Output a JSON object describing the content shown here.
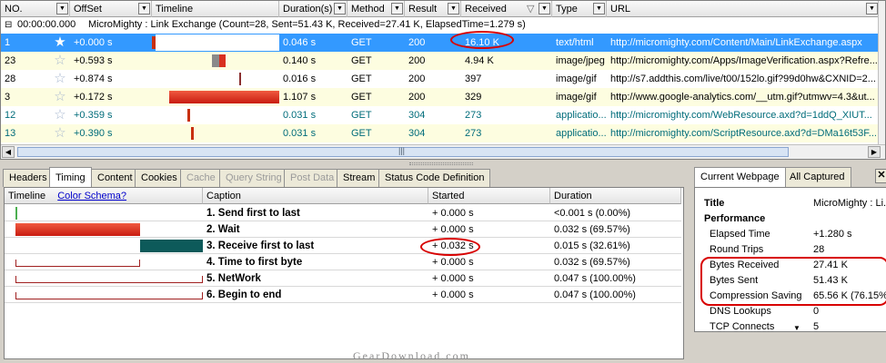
{
  "grid": {
    "headers": [
      "NO.",
      "OffSet",
      "Timeline",
      "Duration(s)",
      "Method",
      "Result",
      "Received",
      "Type",
      "URL"
    ],
    "summary": {
      "time": "00:00:00.000",
      "text": "MicroMighty : Link Exchange  (Count=28, Sent=51.43 K, Received=27.41 K, ElapsedTime=1.279 s)"
    },
    "rows": [
      {
        "no": "1",
        "offset": "+0.000 s",
        "duration": "0.046 s",
        "method": "GET",
        "result": "200",
        "received": "16.10 K",
        "type": "text/html",
        "url": "http://micromighty.com/Content/Main/LinkExchange.aspx",
        "starred": true,
        "style": "sel"
      },
      {
        "no": "23",
        "offset": "+0.593 s",
        "duration": "0.140 s",
        "method": "GET",
        "result": "200",
        "received": "4.94 K",
        "type": "image/jpeg",
        "url": "http://micromighty.com/Apps/ImageVerification.aspx?Refre...",
        "starred": false,
        "style": "cream"
      },
      {
        "no": "28",
        "offset": "+0.874 s",
        "duration": "0.016 s",
        "method": "GET",
        "result": "200",
        "received": "397",
        "type": "image/gif",
        "url": "http://s7.addthis.com/live/t00/152lo.gif?99d0hw&CXNID=2...",
        "starred": false,
        "style": "white"
      },
      {
        "no": "3",
        "offset": "+0.172 s",
        "duration": "1.107 s",
        "method": "GET",
        "result": "200",
        "received": "329",
        "type": "image/gif",
        "url": "http://www.google-analytics.com/__utm.gif?utmwv=4.3&ut...",
        "starred": false,
        "style": "cream"
      },
      {
        "no": "12",
        "offset": "+0.359 s",
        "duration": "0.031 s",
        "method": "GET",
        "result": "304",
        "received": "273",
        "type": "applicatio...",
        "url": "http://micromighty.com/WebResource.axd?d=1ddQ_XIUT...",
        "starred": false,
        "style": "white",
        "teal": true
      },
      {
        "no": "13",
        "offset": "+0.390 s",
        "duration": "0.031 s",
        "method": "GET",
        "result": "304",
        "received": "273",
        "type": "applicatio...",
        "url": "http://micromighty.com/ScriptResource.axd?d=DMa16t53F...",
        "starred": false,
        "style": "cream",
        "teal": true
      }
    ]
  },
  "tabs": [
    "Headers",
    "Timing",
    "Content",
    "Cookies",
    "Cache",
    "Query String",
    "Post Data",
    "Stream",
    "Status Code Definition"
  ],
  "timing": {
    "headers": {
      "timeline": "Timeline",
      "schema_link": "Color Schema?",
      "caption": "Caption",
      "started": "Started",
      "duration": "Duration"
    },
    "rows": [
      {
        "caption": "1.   Send first to last",
        "started": "+ 0.000 s",
        "duration": "<0.001 s  (0.00%)"
      },
      {
        "caption": "2.   Wait",
        "started": "+ 0.000 s",
        "duration": "0.032 s  (69.57%)"
      },
      {
        "caption": "3.   Receive first to last",
        "started": "+ 0.032 s",
        "duration": "0.015 s  (32.61%)"
      },
      {
        "caption": "4.   Time to first byte",
        "started": "+ 0.000 s",
        "duration": "0.032 s  (69.57%)"
      },
      {
        "caption": "5.   NetWork",
        "started": "+ 0.000 s",
        "duration": "0.047 s  (100.00%)"
      },
      {
        "caption": "6.   Begin to end",
        "started": "+ 0.000 s",
        "duration": "0.047 s  (100.00%)"
      }
    ]
  },
  "right_panel": {
    "tabs": [
      "Current Webpage",
      "All Captured"
    ],
    "title_label": "Title",
    "title_value": "MicroMighty : Li...",
    "section": "Performance",
    "items": [
      {
        "label": "Elapsed Time",
        "value": "+1.280 s"
      },
      {
        "label": "Round Trips",
        "value": "28"
      },
      {
        "label": "Bytes Received",
        "value": "27.41 K"
      },
      {
        "label": "Bytes Sent",
        "value": "51.43 K"
      },
      {
        "label": "Compression Saving",
        "value": "65.56 K (76.15%"
      },
      {
        "label": "DNS Lookups",
        "value": "0"
      },
      {
        "label": "TCP Connects",
        "value": "5"
      }
    ]
  },
  "watermark": "GearDownload.com",
  "colors": {
    "selection": "#3399ff",
    "bar_red": "#d83020",
    "bar_teal": "#0d5a5a",
    "highlight": "#d80000"
  }
}
